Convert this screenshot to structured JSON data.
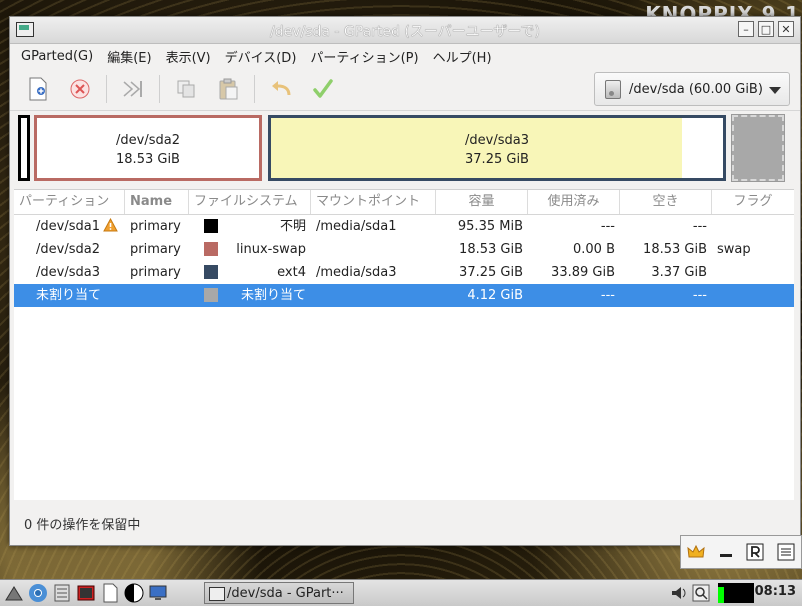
{
  "desktop": {
    "logo": "KNOPPIX 9.1"
  },
  "window": {
    "title": "/dev/sda - GParted (スーパーユーザーで)",
    "controls": {
      "minimize": "–",
      "maximize": "□",
      "close": "✕"
    }
  },
  "menu": [
    "GParted(G)",
    "編集(E)",
    "表示(V)",
    "デバイス(D)",
    "パーティション(P)",
    "ヘルプ(H)"
  ],
  "device_selector": {
    "value": "/dev/sda (60.00 GiB)"
  },
  "graph": {
    "sda2": {
      "name": "/dev/sda2",
      "size": "18.53 GiB"
    },
    "sda3": {
      "name": "/dev/sda3",
      "size": "37.25 GiB"
    }
  },
  "table": {
    "headers": [
      "パーティション",
      "Name",
      "ファイルシステム",
      "マウントポイント",
      "容量",
      "使用済み",
      "空き",
      "フラグ"
    ],
    "rows": [
      {
        "partition": "/dev/sda1",
        "name": "primary",
        "fs": "不明",
        "mount": "/media/sda1",
        "size": "95.35 MiB",
        "used": "---",
        "free": "---",
        "flags": "",
        "color": "#000000"
      },
      {
        "partition": "/dev/sda2",
        "name": "primary",
        "fs": "linux-swap",
        "mount": "",
        "size": "18.53 GiB",
        "used": "0.00 B",
        "free": "18.53 GiB",
        "flags": "swap",
        "color": "#b96a63"
      },
      {
        "partition": "/dev/sda3",
        "name": "primary",
        "fs": "ext4",
        "mount": "/media/sda3",
        "size": "37.25 GiB",
        "used": "33.89 GiB",
        "free": "3.37 GiB",
        "flags": "",
        "color": "#364a63"
      },
      {
        "partition": "未割り当て",
        "name": "",
        "fs": "未割り当て",
        "mount": "",
        "size": "4.12 GiB",
        "used": "---",
        "free": "---",
        "flags": "",
        "color": "#a8a8a8"
      }
    ]
  },
  "status": "0 件の操作を保留中",
  "taskbar": {
    "task": "/dev/sda - GPart···",
    "clock": "08:13"
  }
}
